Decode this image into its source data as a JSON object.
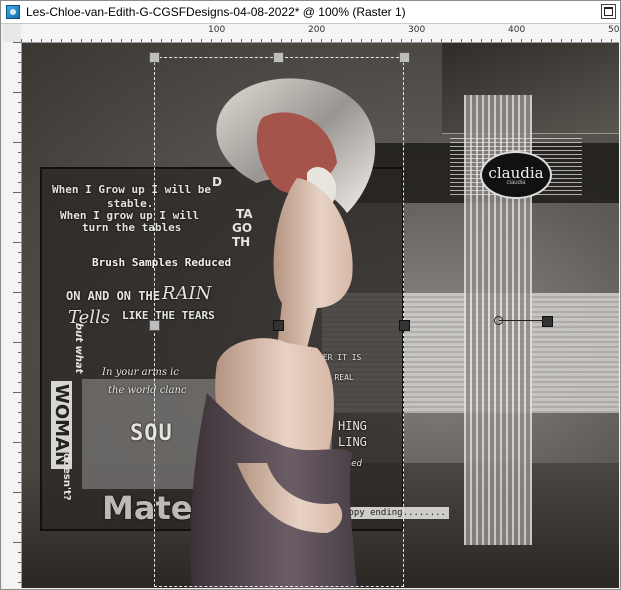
{
  "window": {
    "title": "Les-Chloe-van-Edith-G-CGSFDesigns-04-08-2022* @ 100% (Raster 1)"
  },
  "ruler": {
    "labels": [
      "100",
      "200",
      "300",
      "400",
      "500"
    ]
  },
  "artwork": {
    "logo": {
      "main": "claudia",
      "sub": "claudia"
    },
    "texts": {
      "grow1": "When I Grow up I will be",
      "stable": "stable.",
      "grow2": "When I grow up I will",
      "tables": "turn the tables",
      "brush": "Brush Samples Reduced",
      "onandon": "ON AND ON THE",
      "rain": "RAIN",
      "tell": "Tells",
      "like": "LIKE THE TEARS",
      "arms": "In your arms ic",
      "world": "the world clanc",
      "sou": "SOU",
      "mate": "Mate",
      "happy": "appy ending........",
      "but": "but what",
      "woman": "WOMAN",
      "doesnt": "doesn't?",
      "right1": "HER IT IS",
      "right2": "OR REAL",
      "right3": "HING",
      "right4": "LING",
      "right5": "chained",
      "dv1": "D",
      "dv2": "TA",
      "dv3": "GO",
      "dv4": "TH"
    }
  },
  "colors": {
    "canvas_bg": "#5e5a55",
    "selection": "#e8e8e8",
    "handle": "#bdbdbd"
  }
}
